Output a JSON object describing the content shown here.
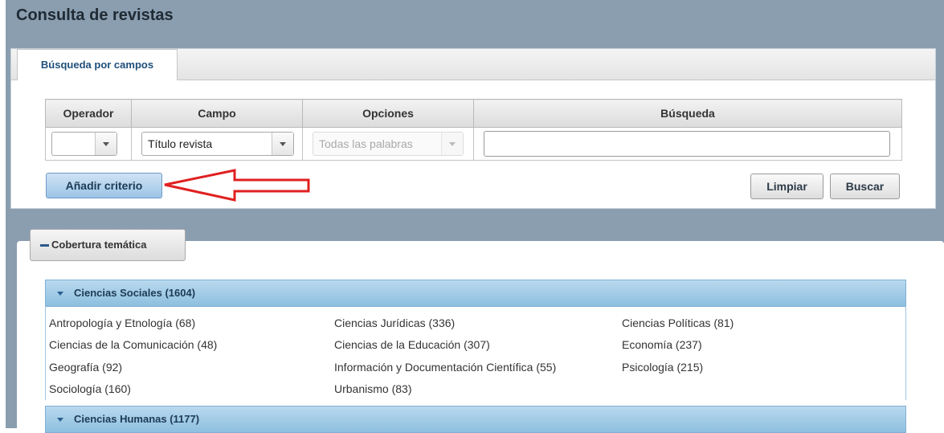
{
  "page": {
    "title": "Consulta de revistas"
  },
  "search": {
    "tab_label": "Búsqueda por campos",
    "columns": [
      "Operador",
      "Campo",
      "Opciones",
      "Búsqueda"
    ],
    "operator_value": "",
    "field_value": "Título revista",
    "options_value": "Todas las palabras",
    "query_value": "",
    "add_criterion_label": "Añadir criterio",
    "clear_label": "Limpiar",
    "search_label": "Buscar"
  },
  "annotation": {
    "arrow_color": "#e02020"
  },
  "coverage": {
    "toggle_label": "Cobertura temática",
    "sections": [
      {
        "label": "Ciencias Sociales (1604)",
        "items": [
          "Antropología y Etnología (68)",
          "Ciencias Jurídicas (336)",
          "Ciencias Políticas (81)",
          "Ciencias de la Comunicación (48)",
          "Ciencias de la Educación (307)",
          "Economía (237)",
          "Geografía (92)",
          "Información y Documentación Científica (55)",
          "Psicología (215)",
          "Sociología (160)",
          "Urbanismo (83)"
        ]
      },
      {
        "label": "Ciencias Humanas (1177)"
      }
    ]
  }
}
